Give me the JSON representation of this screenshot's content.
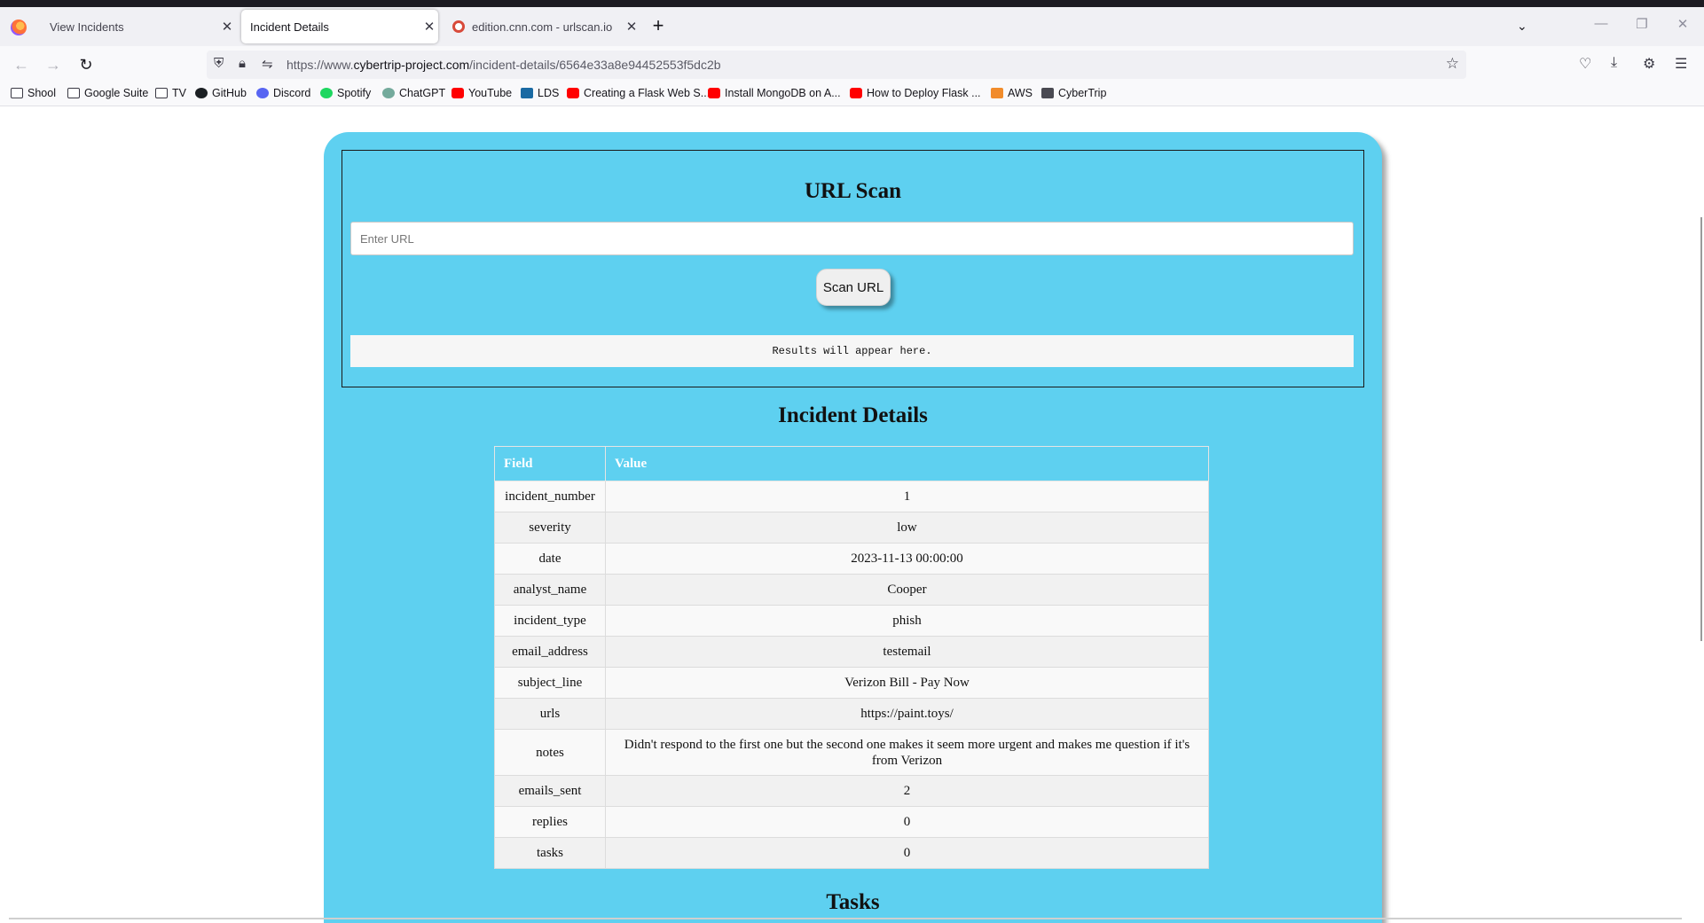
{
  "browser": {
    "tabs": [
      {
        "title": "View Incidents",
        "active": false
      },
      {
        "title": "Incident Details",
        "active": true
      },
      {
        "title": "edition.cnn.com - urlscan.io",
        "active": false
      }
    ],
    "url_prefix": "https://www.",
    "url_domain": "cybertrip-project.com",
    "url_path": "/incident-details/6564e33a8e94452553f5dc2b",
    "bookmarks": [
      "Shool",
      "Google Suite",
      "TV",
      "GitHub",
      "Discord",
      "Spotify",
      "ChatGPT",
      "YouTube",
      "LDS",
      "Creating a Flask Web S...",
      "Install MongoDB on A...",
      "How to Deploy Flask ...",
      "AWS",
      "CyberTrip"
    ]
  },
  "scan": {
    "title": "URL Scan",
    "input_placeholder": "Enter URL",
    "button_label": "Scan URL",
    "results_text": "Results will appear here."
  },
  "details": {
    "title": "Incident Details",
    "col_field": "Field",
    "col_value": "Value",
    "rows": [
      {
        "field": "incident_number",
        "value": "1"
      },
      {
        "field": "severity",
        "value": "low"
      },
      {
        "field": "date",
        "value": "2023-11-13 00:00:00"
      },
      {
        "field": "analyst_name",
        "value": "Cooper"
      },
      {
        "field": "incident_type",
        "value": "phish"
      },
      {
        "field": "email_address",
        "value": "testemail"
      },
      {
        "field": "subject_line",
        "value": "Verizon Bill - Pay Now"
      },
      {
        "field": "urls",
        "value": "https://paint.toys/"
      },
      {
        "field": "notes",
        "value": "Didn't respond to the first one but the second one makes it seem more urgent and makes me question if it's from Verizon"
      },
      {
        "field": "emails_sent",
        "value": "2"
      },
      {
        "field": "replies",
        "value": "0"
      },
      {
        "field": "tasks",
        "value": "0"
      }
    ]
  },
  "tasks": {
    "title": "Tasks"
  },
  "colors": {
    "card": "#5ed0f0",
    "table_header_text": "#ffffff"
  }
}
